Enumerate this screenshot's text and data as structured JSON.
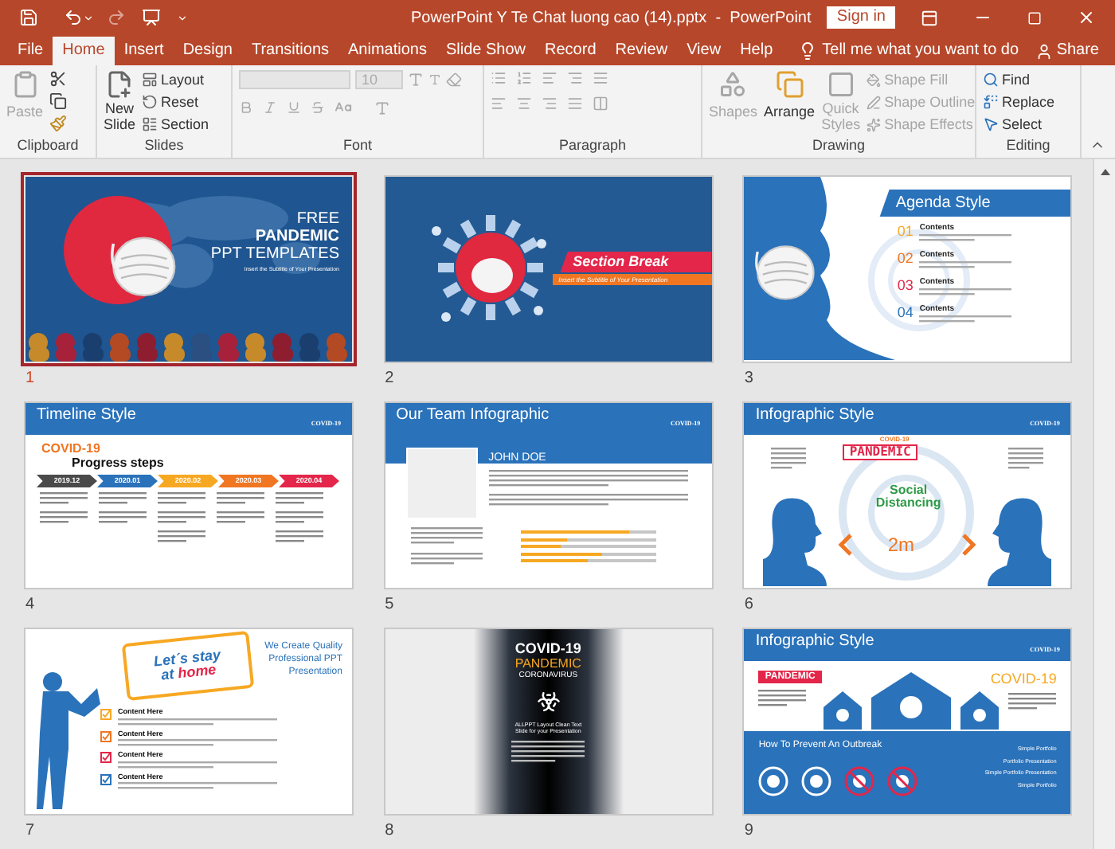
{
  "window": {
    "title": "PowerPoint Y Te Chat luong cao (14).pptx  -  PowerPoint",
    "sign_in": "Sign in"
  },
  "tabs": [
    {
      "label": "File",
      "selected": false
    },
    {
      "label": "Home",
      "selected": true
    },
    {
      "label": "Insert",
      "selected": false
    },
    {
      "label": "Design",
      "selected": false
    },
    {
      "label": "Transitions",
      "selected": false
    },
    {
      "label": "Animations",
      "selected": false
    },
    {
      "label": "Slide Show",
      "selected": false
    },
    {
      "label": "Record",
      "selected": false
    },
    {
      "label": "Review",
      "selected": false
    },
    {
      "label": "View",
      "selected": false
    },
    {
      "label": "Help",
      "selected": false
    }
  ],
  "tell_me": "Tell me what you want to do",
  "share": "Share",
  "ribbon": {
    "clipboard": {
      "label": "Clipboard",
      "paste": {
        "label": "Paste",
        "disabled": true
      }
    },
    "slides": {
      "label": "Slides",
      "new_slide": [
        "New",
        "Slide"
      ],
      "items": [
        "Layout",
        "Reset",
        "Section"
      ]
    },
    "font": {
      "label": "Font",
      "size": "10"
    },
    "paragraph": {
      "label": "Paragraph"
    },
    "drawing": {
      "label": "Drawing",
      "shapes": {
        "label": "Shapes",
        "disabled": true
      },
      "arrange": {
        "label": "Arrange",
        "disabled": false
      },
      "quick_styles": {
        "label": "Quick Styles",
        "disabled": true
      },
      "items": [
        {
          "label": "Shape Fill",
          "disabled": true
        },
        {
          "label": "Shape Outline",
          "disabled": true
        },
        {
          "label": "Shape Effects",
          "disabled": true
        }
      ]
    },
    "editing": {
      "label": "Editing",
      "items": [
        "Find",
        "Replace",
        "Select"
      ]
    }
  },
  "slides": [
    {
      "number": "1",
      "selected": true,
      "kind": "cover",
      "lines": [
        "FREE",
        "PANDEMIC",
        "PPT TEMPLATES"
      ],
      "subtitle": "Insert the Subtitle of Your Presentation"
    },
    {
      "number": "2",
      "selected": false,
      "kind": "section",
      "title": "Section Break",
      "subtitle": "Insert the Subtitle of Your Presentation"
    },
    {
      "number": "3",
      "selected": false,
      "kind": "agenda",
      "title": "Agenda Style",
      "items": [
        {
          "number": "01",
          "label": "Contents",
          "color": "#f7a823"
        },
        {
          "number": "02",
          "label": "Contents",
          "color": "#f07622"
        },
        {
          "number": "03",
          "label": "Contents",
          "color": "#e3264a"
        },
        {
          "number": "04",
          "label": "Contents",
          "color": "#2a72ba"
        }
      ]
    },
    {
      "number": "4",
      "selected": false,
      "kind": "timeline",
      "title": "Timeline Style",
      "tag": "COVID-19",
      "heading": "COVID-19",
      "subheading": "Progress steps",
      "steps": [
        {
          "label": "2019.12",
          "color": "#4a4a4a"
        },
        {
          "label": "2020.01",
          "color": "#2a72ba"
        },
        {
          "label": "2020.02",
          "color": "#f7a823"
        },
        {
          "label": "2020.03",
          "color": "#f07622"
        },
        {
          "label": "2020.04",
          "color": "#e3264a"
        }
      ]
    },
    {
      "number": "5",
      "selected": false,
      "kind": "team",
      "title": "Our Team Infographic",
      "name": "JOHN DOE",
      "tag": "COVID-19",
      "bars": [
        {
          "level": 0.8
        },
        {
          "level": 0.35
        },
        {
          "level": 0.3
        },
        {
          "level": 0.6
        },
        {
          "level": 0.5
        }
      ]
    },
    {
      "number": "6",
      "selected": false,
      "kind": "infographic",
      "title": "Infographic Style",
      "tag": "COVID-19",
      "stamp_top": "COVID-19",
      "stamp": "PANDEMIC",
      "center": [
        "Social",
        "Distancing"
      ],
      "distance": "2m"
    },
    {
      "number": "7",
      "selected": false,
      "kind": "stay_home",
      "bubble_top": "Let´s stay",
      "bubble_at": "at",
      "bubble_home": "home",
      "tagline": "We Create Quality Professional PPT Presentation",
      "checklist": [
        {
          "label": "Content Here",
          "color": "#f7a823"
        },
        {
          "label": "Content Here",
          "color": "#f07622"
        },
        {
          "label": "Content Here",
          "color": "#e3264a"
        },
        {
          "label": "Content Here",
          "color": "#2a72ba"
        }
      ]
    },
    {
      "number": "8",
      "selected": false,
      "kind": "dark",
      "title": "COVID-19",
      "subtitle": "PANDEMIC",
      "line": "CORONAVIRUS",
      "caption": "ALLPPT Layout Clean Text Slide for your Presentation"
    },
    {
      "number": "9",
      "selected": false,
      "kind": "outbreak",
      "title": "Infographic Style",
      "tag": "COVID-19",
      "badge": "PANDEMIC",
      "heading": "COVID-19",
      "footer": "How To Prevent An Outbreak",
      "list": [
        "Simple Portfolio",
        "Portfolio Presentation",
        "Simple Portfolio Presentation",
        "Simple Portfolio"
      ]
    }
  ]
}
